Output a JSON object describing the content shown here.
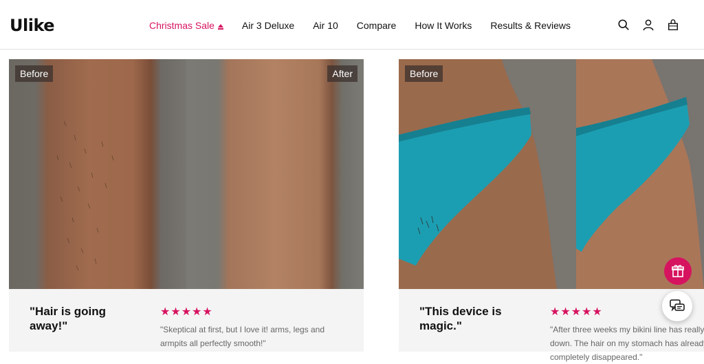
{
  "brand": {
    "logo_text": "Ulike"
  },
  "nav": {
    "items": [
      {
        "label": "Christmas Sale"
      },
      {
        "label": "Air 3 Deluxe"
      },
      {
        "label": "Air 10"
      },
      {
        "label": "Compare"
      },
      {
        "label": "How It Works"
      },
      {
        "label": "Results & Reviews"
      }
    ]
  },
  "header_icons": [
    "search-icon",
    "account-icon",
    "cart-icon"
  ],
  "colors": {
    "accent": "#d6135f"
  },
  "cards": [
    {
      "before_label": "Before",
      "after_label": "After",
      "quote": "\"Hair is going away!\"",
      "stars": "★★★★★",
      "review": "\"Skeptical at first, but I love it! arms, legs and armpits all perfectly smooth!\""
    },
    {
      "before_label": "Before",
      "quote": "\"This device is magic.\"",
      "stars": "★★★★★",
      "review": "\"After three weeks my bikini line has really t down. The hair on my stomach has already completely disappeared.\""
    }
  ],
  "floating": {
    "gift_icon": "gift-icon",
    "chat_icon": "chat-icon"
  }
}
